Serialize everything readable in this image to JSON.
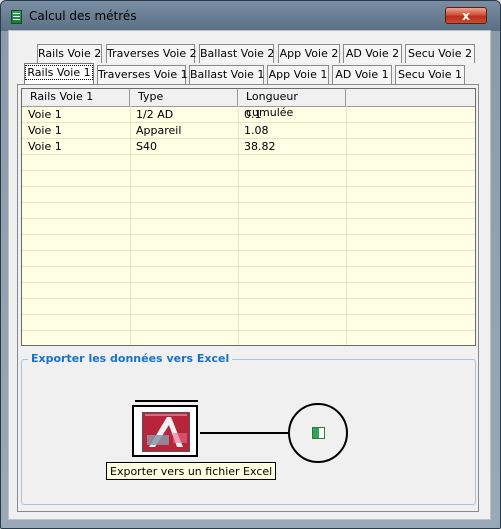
{
  "window": {
    "title": "Calcul des métrés",
    "close_label": "x"
  },
  "tabs_row1": [
    "Rails Voie 2",
    "Traverses Voie 2",
    "Ballast Voie 2",
    "App Voie 2",
    "AD Voie 2",
    "Secu Voie 2"
  ],
  "tabs_row2": [
    "Rails Voie 1",
    "Traverses Voie 1",
    "Ballast Voie 1",
    "App Voie 1",
    "AD Voie 1",
    "Secu Voie 1"
  ],
  "active_tab": "Rails Voie 1",
  "table": {
    "columns": [
      "Rails Voie 1",
      "Type",
      "Longueur cumulée"
    ],
    "rows": [
      [
        "Voie 1",
        "1/2 AD",
        "0.1"
      ],
      [
        "Voie 1",
        "Appareil",
        "1.08"
      ],
      [
        "Voie 1",
        "S40",
        "38.82"
      ]
    ]
  },
  "export": {
    "group_title": "Exporter les données vers Excel",
    "tooltip": "Exporter vers  un fichier Excel",
    "excel_icon": "excel-icon"
  },
  "colors": {
    "grid_bg": "#ffffe6",
    "group_title": "#1a72c8",
    "close_btn": "#c94b31"
  }
}
